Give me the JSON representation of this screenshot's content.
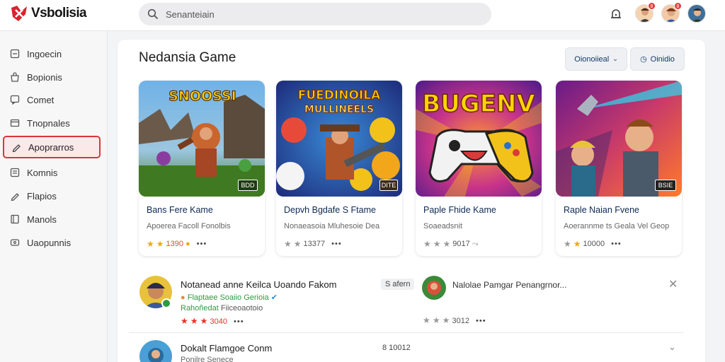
{
  "app": {
    "logo_text": "Vsbolisia",
    "search_placeholder": "Senanteiain",
    "notification_count_1": "8",
    "notification_count_2": "8"
  },
  "sidebar": {
    "items": [
      {
        "label": "Ingoecin",
        "icon": "square-icon"
      },
      {
        "label": "Bopionis",
        "icon": "bag-icon"
      },
      {
        "label": "Comet",
        "icon": "chat-icon"
      },
      {
        "label": "Tnopnales",
        "icon": "card-icon"
      },
      {
        "label": "Apoprarros",
        "icon": "pen-icon",
        "active": true
      },
      {
        "label": "Komnis",
        "icon": "list-icon"
      },
      {
        "label": "Flapios",
        "icon": "pen-icon"
      },
      {
        "label": "Manols",
        "icon": "book-icon"
      },
      {
        "label": "Uaopunnis",
        "icon": "gamepad-icon"
      }
    ]
  },
  "main": {
    "title": "Nedansia Game",
    "filter_button": "Oionoiieal",
    "secondary_button": "Oinidio",
    "cards": [
      {
        "banner": "SNOOSSI",
        "tag": "BDD",
        "title": "Bans Fere Kame",
        "subtitle": "Apoerea Facoll Fonolbis",
        "rating": "1390",
        "stars_on": 2,
        "stars_total": 2
      },
      {
        "banner": "FUEDINOILA",
        "banner2": "MULLINEELS",
        "tag": "DITE",
        "title": "Depvh Bgdafe S Ftame",
        "subtitle": "Nonaeasoia Mluhesoie Dea",
        "rating": "13377",
        "stars_on": 0,
        "stars_total": 2
      },
      {
        "banner": "BUGENV",
        "tag": "",
        "title": "Paple Fhide Kame",
        "subtitle": "Soaeadsnit",
        "rating": "9017",
        "stars_on": 0,
        "stars_total": 3
      },
      {
        "banner": "",
        "tag": "BSIE",
        "title": "Raple Naian Fvene",
        "subtitle": "Aoerannme ts Geala Vel Geop",
        "rating": "10000",
        "stars_on": 1,
        "stars_total": 2
      }
    ]
  },
  "list": {
    "rows": [
      {
        "title": "Notanead anne Keilca Uoando Fakom",
        "line1": "Flaptaee Soaiio Gerioia",
        "line2_a": "Rahoñedat",
        "line2_b": "Fiiceoaotoio",
        "rating": "3040",
        "tag": "S afern",
        "side_title": "Nalolae Pamgar Penangrnor...",
        "side_rating": "3012"
      },
      {
        "title": "Dokalt Flamgoe Conm",
        "line1": "Ponilre Senece",
        "tag": "8 10012"
      }
    ]
  }
}
